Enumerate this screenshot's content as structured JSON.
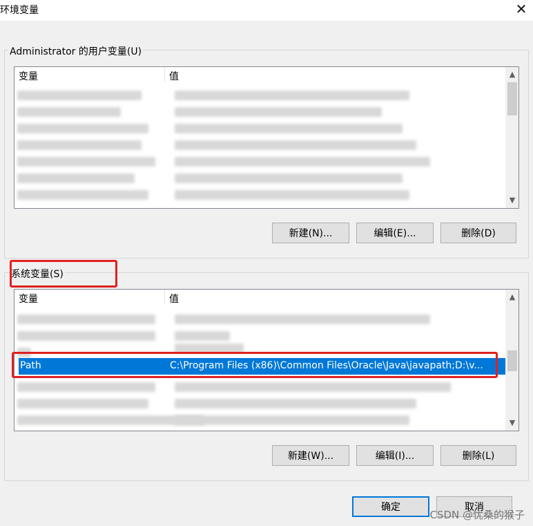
{
  "window": {
    "title": "环境变量",
    "close_glyph": "✕"
  },
  "user_vars": {
    "legend": "Administrator 的用户变量(U)",
    "col_var": "变量",
    "col_value": "值",
    "buttons": {
      "new": "新建(N)...",
      "edit": "编辑(E)...",
      "delete": "删除(D)"
    }
  },
  "system_vars": {
    "legend": "系统变量(S)",
    "col_var": "变量",
    "col_value": "值",
    "selected_row": {
      "name": "Path",
      "value": "C:\\Program Files (x86)\\Common Files\\Oracle\\Java\\javapath;D:\\v..."
    },
    "buttons": {
      "new": "新建(W)...",
      "edit": "编辑(I)...",
      "delete": "删除(L)"
    }
  },
  "footer": {
    "ok": "确定",
    "cancel": "取消"
  },
  "watermark": "CSDN @忧桑的猴子",
  "colors": {
    "selection": "#0078d7",
    "highlight_box": "#e02020"
  }
}
